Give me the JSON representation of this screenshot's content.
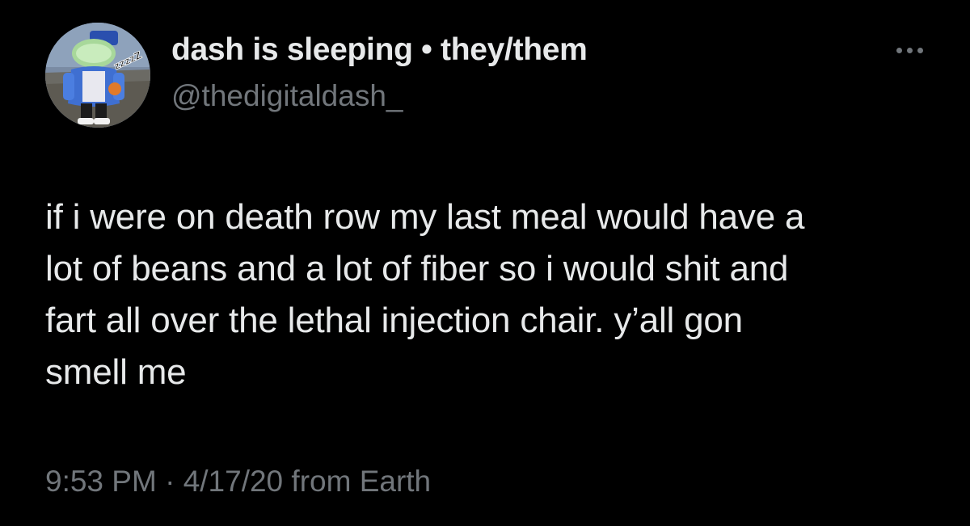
{
  "author": {
    "display_name": "dash is sleeping • they/them",
    "handle": "@thedigitaldash_",
    "avatar_text": "zzzzZ"
  },
  "tweet": {
    "text_lines": [
      "if i were on death row my last meal would have a",
      "lot of beans and a lot of fiber so i would shit and",
      "fart all over the lethal injection chair. y’all gon",
      "smell me"
    ]
  },
  "meta": {
    "time": "9:53 PM",
    "separator": " · ",
    "date": "4/17/20",
    "source": " from Earth"
  },
  "menu": {
    "icon": "more-horizontal-icon"
  },
  "colors": {
    "background": "#000000",
    "primary_text": "#e7e9ea",
    "secondary_text": "#71767b"
  }
}
